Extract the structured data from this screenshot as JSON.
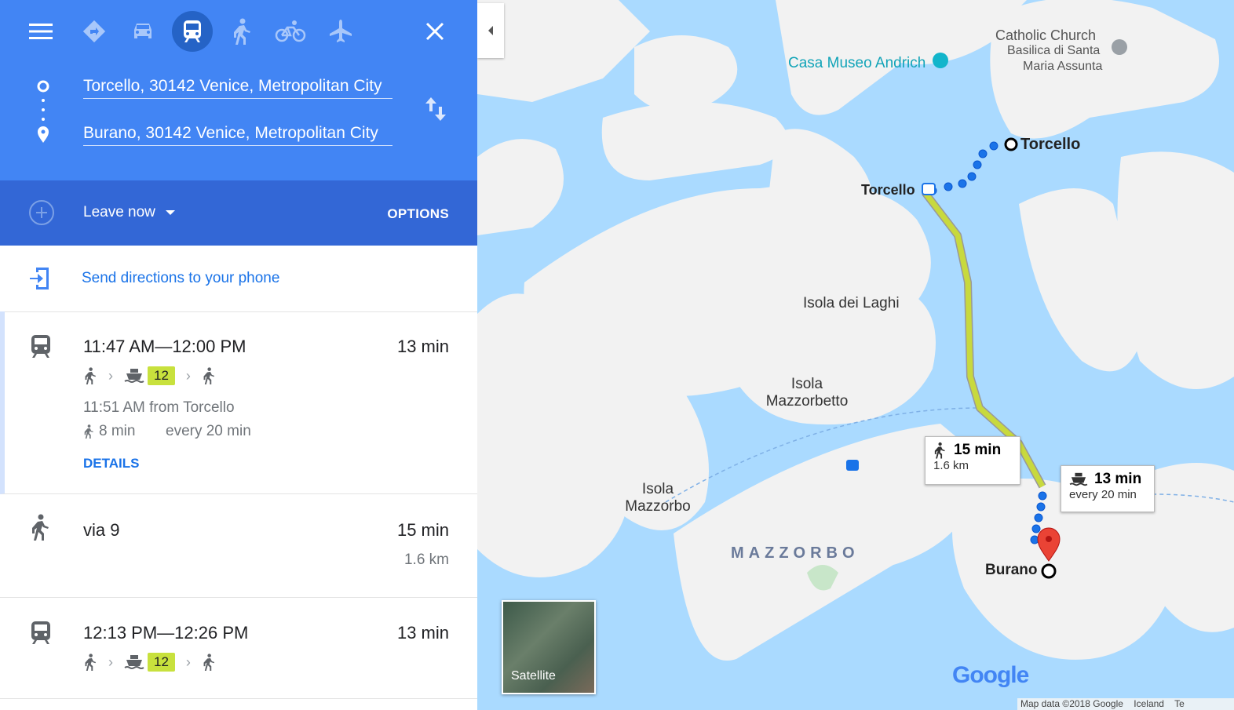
{
  "header": {
    "origin": "Torcello, 30142 Venice, Metropolitan City",
    "destination": "Burano, 30142 Venice, Metropolitan City",
    "departure": "Leave now",
    "options_label": "OPTIONS"
  },
  "send_directions": "Send directions to your phone",
  "routes": [
    {
      "time": "11:47 AM—12:00 PM",
      "duration": "13 min",
      "line": "12",
      "departure_info": "11:51 AM from Torcello",
      "walk_time": "8 min",
      "frequency": "every 20 min",
      "details_label": "DETAILS"
    },
    {
      "via": "via 9",
      "duration": "15 min",
      "distance": "1.6 km"
    },
    {
      "time": "12:13 PM—12:26 PM",
      "duration": "13 min",
      "line": "12"
    }
  ],
  "map": {
    "labels": {
      "church": "Catholic Church",
      "basilica_l1": "Basilica di Santa",
      "basilica_l2": "Maria Assunta",
      "museo": "Casa Museo Andrich",
      "torcello_stop": "Torcello",
      "torcello_dest": "Torcello",
      "laghi": "Isola dei Laghi",
      "mazzorbetto_l1": "Isola",
      "mazzorbetto_l2": "Mazzorbetto",
      "mazzorbo_l1": "Isola",
      "mazzorbo_l2": "Mazzorbo",
      "mazzorbo_caps": "MAZZORBO",
      "burano": "Burano"
    },
    "walk_callout": {
      "time": "15 min",
      "distance": "1.6 km"
    },
    "ferry_callout": {
      "time": "13 min",
      "frequency": "every 20 min"
    },
    "satellite_label": "Satellite",
    "google": "Google",
    "footer": "Map data ©2018 Google    Iceland    Te"
  },
  "colors": {
    "blue": "#4285f4",
    "dark_blue": "#3367d6",
    "route_green": "#c8d93e",
    "water": "#aadaff",
    "land": "#f2f2f2"
  }
}
